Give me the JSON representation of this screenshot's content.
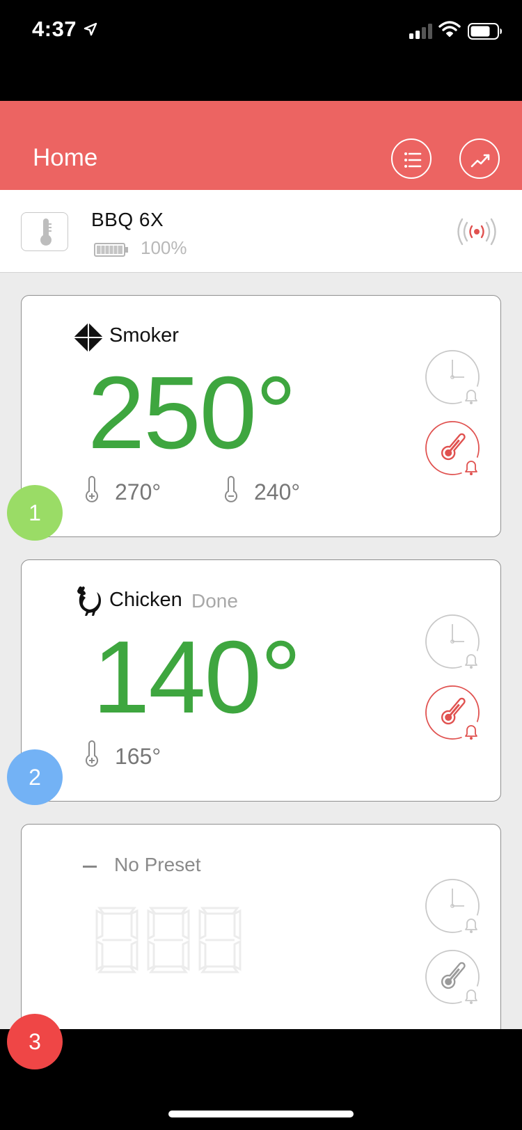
{
  "status_bar": {
    "time": "4:37"
  },
  "header": {
    "title": "Home",
    "colors": {
      "accent": "#ec6462"
    }
  },
  "device": {
    "name": "BBQ 6X",
    "battery": "100%",
    "icons": [
      "thermometer-icon",
      "battery-icon",
      "broadcast-signal-icon"
    ]
  },
  "probes": [
    {
      "number": "1",
      "preset_name": "Smoker",
      "preset_icon": "smoker-diamond-icon",
      "temperature": "250°",
      "targets": [
        {
          "icon": "thermometer-plus-icon",
          "value": "270°"
        },
        {
          "icon": "thermometer-minus-icon",
          "value": "240°"
        }
      ],
      "badge_color": "#9adc66"
    },
    {
      "number": "2",
      "preset_name": "Chicken",
      "status": "Done",
      "preset_icon": "rooster-icon",
      "temperature": "140°",
      "targets": [
        {
          "icon": "thermometer-plus-icon",
          "value": "165°"
        }
      ],
      "badge_color": "#73b2f5"
    },
    {
      "number": "3",
      "preset_name": "No Preset",
      "temperature_placeholder": "888",
      "badge_color": "#ef4646"
    }
  ]
}
